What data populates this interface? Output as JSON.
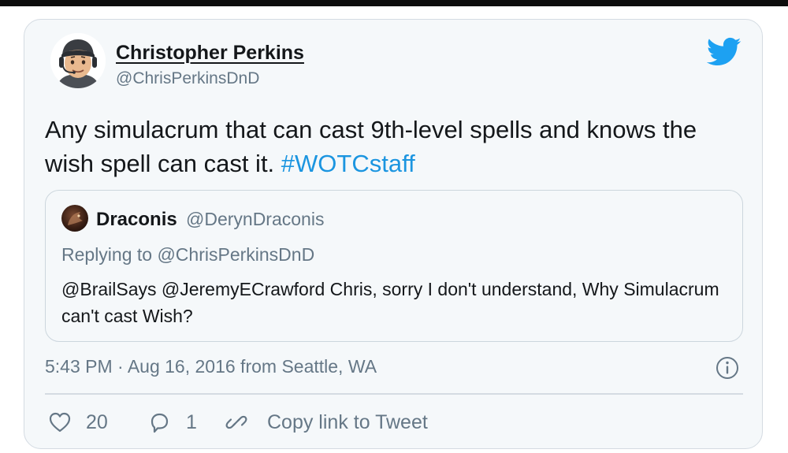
{
  "tweet": {
    "author": {
      "name": "Christopher Perkins",
      "handle": "@ChrisPerkinsDnD"
    },
    "brand_icon": "twitter-bird-icon",
    "text": "Any simulacrum that can cast 9th-level spells and knows the wish spell can cast it.",
    "hashtag": "#WOTCstaff",
    "quoted_tweet": {
      "author_name": "Draconis",
      "author_handle": "@DerynDraconis",
      "replying_to": "Replying to @ChrisPerkinsDnD",
      "text": "@BrailSays @JeremyECrawford Chris, sorry I don't understand, Why Simulacrum can't cast Wish?"
    },
    "timestamp": "5:43 PM · Aug 16, 2016 from Seattle, WA",
    "info_icon": "info-icon",
    "actions": {
      "likes": "20",
      "replies": "1",
      "copy_link_label": "Copy link to Tweet"
    }
  },
  "colors": {
    "accent": "#1b95e0",
    "background": "#f5f8fa",
    "secondary_text": "#657786",
    "primary_text": "#14171a"
  }
}
